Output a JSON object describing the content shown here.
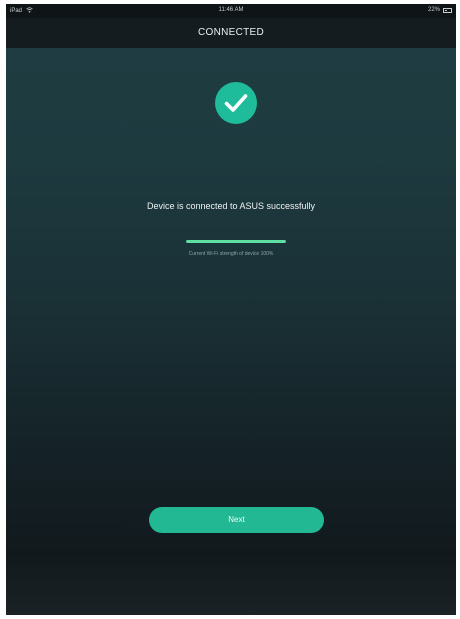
{
  "status_bar": {
    "carrier": "iPad",
    "time": "11:46 AM",
    "battery": "22%"
  },
  "header": {
    "title": "CONNECTED"
  },
  "main": {
    "message": "Device is connected to ASUS successfully",
    "wifi_strength_text": "Current Wi-Fi strength of device 100%",
    "wifi_strength_percent": 100
  },
  "next_button": {
    "label": "Next"
  },
  "colors": {
    "accent": "#1ebc9a",
    "progress": "#5ee0a3",
    "background_top": "#1f3d42",
    "background_bottom": "#12191d"
  },
  "icons": {
    "success": "checkmark-icon",
    "wifi": "wifi-icon",
    "battery": "battery-icon"
  }
}
